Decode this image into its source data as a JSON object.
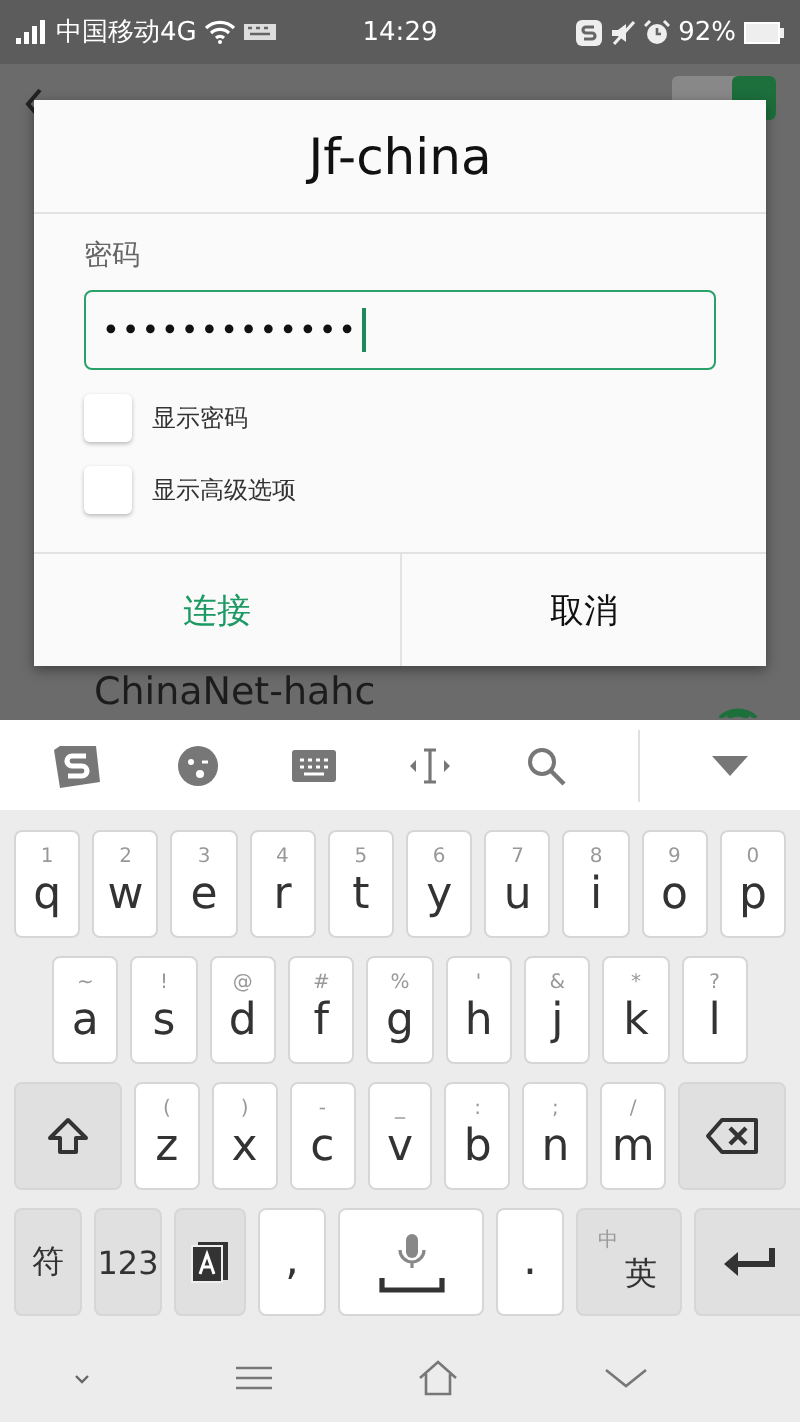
{
  "status_bar": {
    "carrier": "中国移动4G",
    "time": "14:29",
    "battery": "92%"
  },
  "background": {
    "wlan_on": true,
    "network": "ChinaNet-hahc"
  },
  "dialog": {
    "title": "Jf-china",
    "field_label": "密码",
    "password": "•••••••••••••",
    "options": [
      {
        "label": "显示密码",
        "checked": false
      },
      {
        "label": "显示高级选项",
        "checked": false
      }
    ],
    "buttons": [
      {
        "label": "连接",
        "kind": "primary"
      },
      {
        "label": "取消",
        "kind": "plain"
      }
    ]
  },
  "keyboard": {
    "rows": [
      [
        {
          "kind": "char",
          "main": "q",
          "hint": "1"
        },
        {
          "kind": "char",
          "main": "w",
          "hint": "2"
        },
        {
          "kind": "char",
          "main": "e",
          "hint": "3"
        },
        {
          "kind": "char",
          "main": "r",
          "hint": "4"
        },
        {
          "kind": "char",
          "main": "t",
          "hint": "5"
        },
        {
          "kind": "char",
          "main": "y",
          "hint": "6"
        },
        {
          "kind": "char",
          "main": "u",
          "hint": "7"
        },
        {
          "kind": "char",
          "main": "i",
          "hint": "8"
        },
        {
          "kind": "char",
          "main": "o",
          "hint": "9"
        },
        {
          "kind": "char",
          "main": "p",
          "hint": "0"
        }
      ],
      [
        {
          "kind": "char",
          "main": "a",
          "hint": "~"
        },
        {
          "kind": "char",
          "main": "s",
          "hint": "!"
        },
        {
          "kind": "char",
          "main": "d",
          "hint": "@"
        },
        {
          "kind": "char",
          "main": "f",
          "hint": "#"
        },
        {
          "kind": "char",
          "main": "g",
          "hint": "%"
        },
        {
          "kind": "char",
          "main": "h",
          "hint": "'"
        },
        {
          "kind": "char",
          "main": "j",
          "hint": "&"
        },
        {
          "kind": "char",
          "main": "k",
          "hint": "*"
        },
        {
          "kind": "char",
          "main": "l",
          "hint": "?"
        }
      ],
      [
        {
          "kind": "shift"
        },
        {
          "kind": "char",
          "main": "z",
          "hint": "("
        },
        {
          "kind": "char",
          "main": "x",
          "hint": ")"
        },
        {
          "kind": "char",
          "main": "c",
          "hint": "-"
        },
        {
          "kind": "char",
          "main": "v",
          "hint": "_"
        },
        {
          "kind": "char",
          "main": "b",
          "hint": ":"
        },
        {
          "kind": "char",
          "main": "n",
          "hint": ";"
        },
        {
          "kind": "char",
          "main": "m",
          "hint": "/"
        },
        {
          "kind": "delete"
        }
      ]
    ],
    "bottom_row": [
      {
        "kind": "text",
        "main": "符"
      },
      {
        "kind": "text",
        "main": "123"
      },
      {
        "kind": "book"
      },
      {
        "kind": "char",
        "main": ","
      },
      {
        "kind": "space"
      },
      {
        "kind": "char",
        "main": "."
      },
      {
        "kind": "lang",
        "main": "英",
        "hint": "中"
      },
      {
        "kind": "enter"
      }
    ]
  }
}
